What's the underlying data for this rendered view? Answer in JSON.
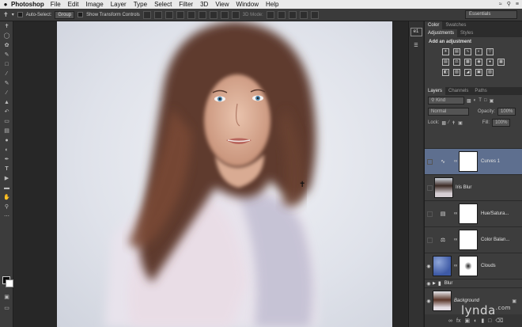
{
  "menubar": {
    "app": "Photoshop",
    "items": [
      "File",
      "Edit",
      "Image",
      "Layer",
      "Type",
      "Select",
      "Filter",
      "3D",
      "View",
      "Window",
      "Help"
    ]
  },
  "options": {
    "auto_select_label": "Auto-Select:",
    "auto_select_value": "Group",
    "transform_label": "Show Transform Controls",
    "mode_3d": "3D Mode:",
    "workspace": "Essentials"
  },
  "dock": {
    "badge": "e1"
  },
  "panels": {
    "color_tabs": [
      "Color",
      "Swatches"
    ],
    "adj_tabs": [
      "Adjustments",
      "Styles"
    ],
    "adj_title": "Add an adjustment",
    "layer_tabs": [
      "Layers",
      "Channels",
      "Paths"
    ],
    "kind_label": "Kind",
    "blend_mode": "Normal",
    "opacity_label": "Opacity:",
    "opacity_value": "100%",
    "lock_label": "Lock:",
    "fill_label": "Fill:",
    "fill_value": "100%"
  },
  "layers": [
    {
      "name": "Curves 1",
      "visible": false,
      "type": "adjustment",
      "icon": "curves-icon",
      "active": true
    },
    {
      "name": "Iris Blur",
      "visible": false,
      "type": "smart",
      "active": false
    },
    {
      "name": "Hue/Satura...",
      "visible": false,
      "type": "adjustment",
      "icon": "hue-saturation-icon",
      "active": false
    },
    {
      "name": "Color Balan...",
      "visible": false,
      "type": "adjustment",
      "icon": "color-balance-icon",
      "active": false
    },
    {
      "name": "Clouds",
      "visible": true,
      "type": "pixel",
      "active": false
    },
    {
      "name": "Blur",
      "visible": true,
      "type": "group",
      "active": false
    },
    {
      "name": "Background",
      "visible": true,
      "type": "background",
      "active": false
    }
  ],
  "watermark": {
    "brand": "lynda",
    "suffix": ".com"
  },
  "colors": {
    "active_layer": "#5e6f8f",
    "panel_bg": "#3d3d3d",
    "canvas_bg": "#272727"
  }
}
